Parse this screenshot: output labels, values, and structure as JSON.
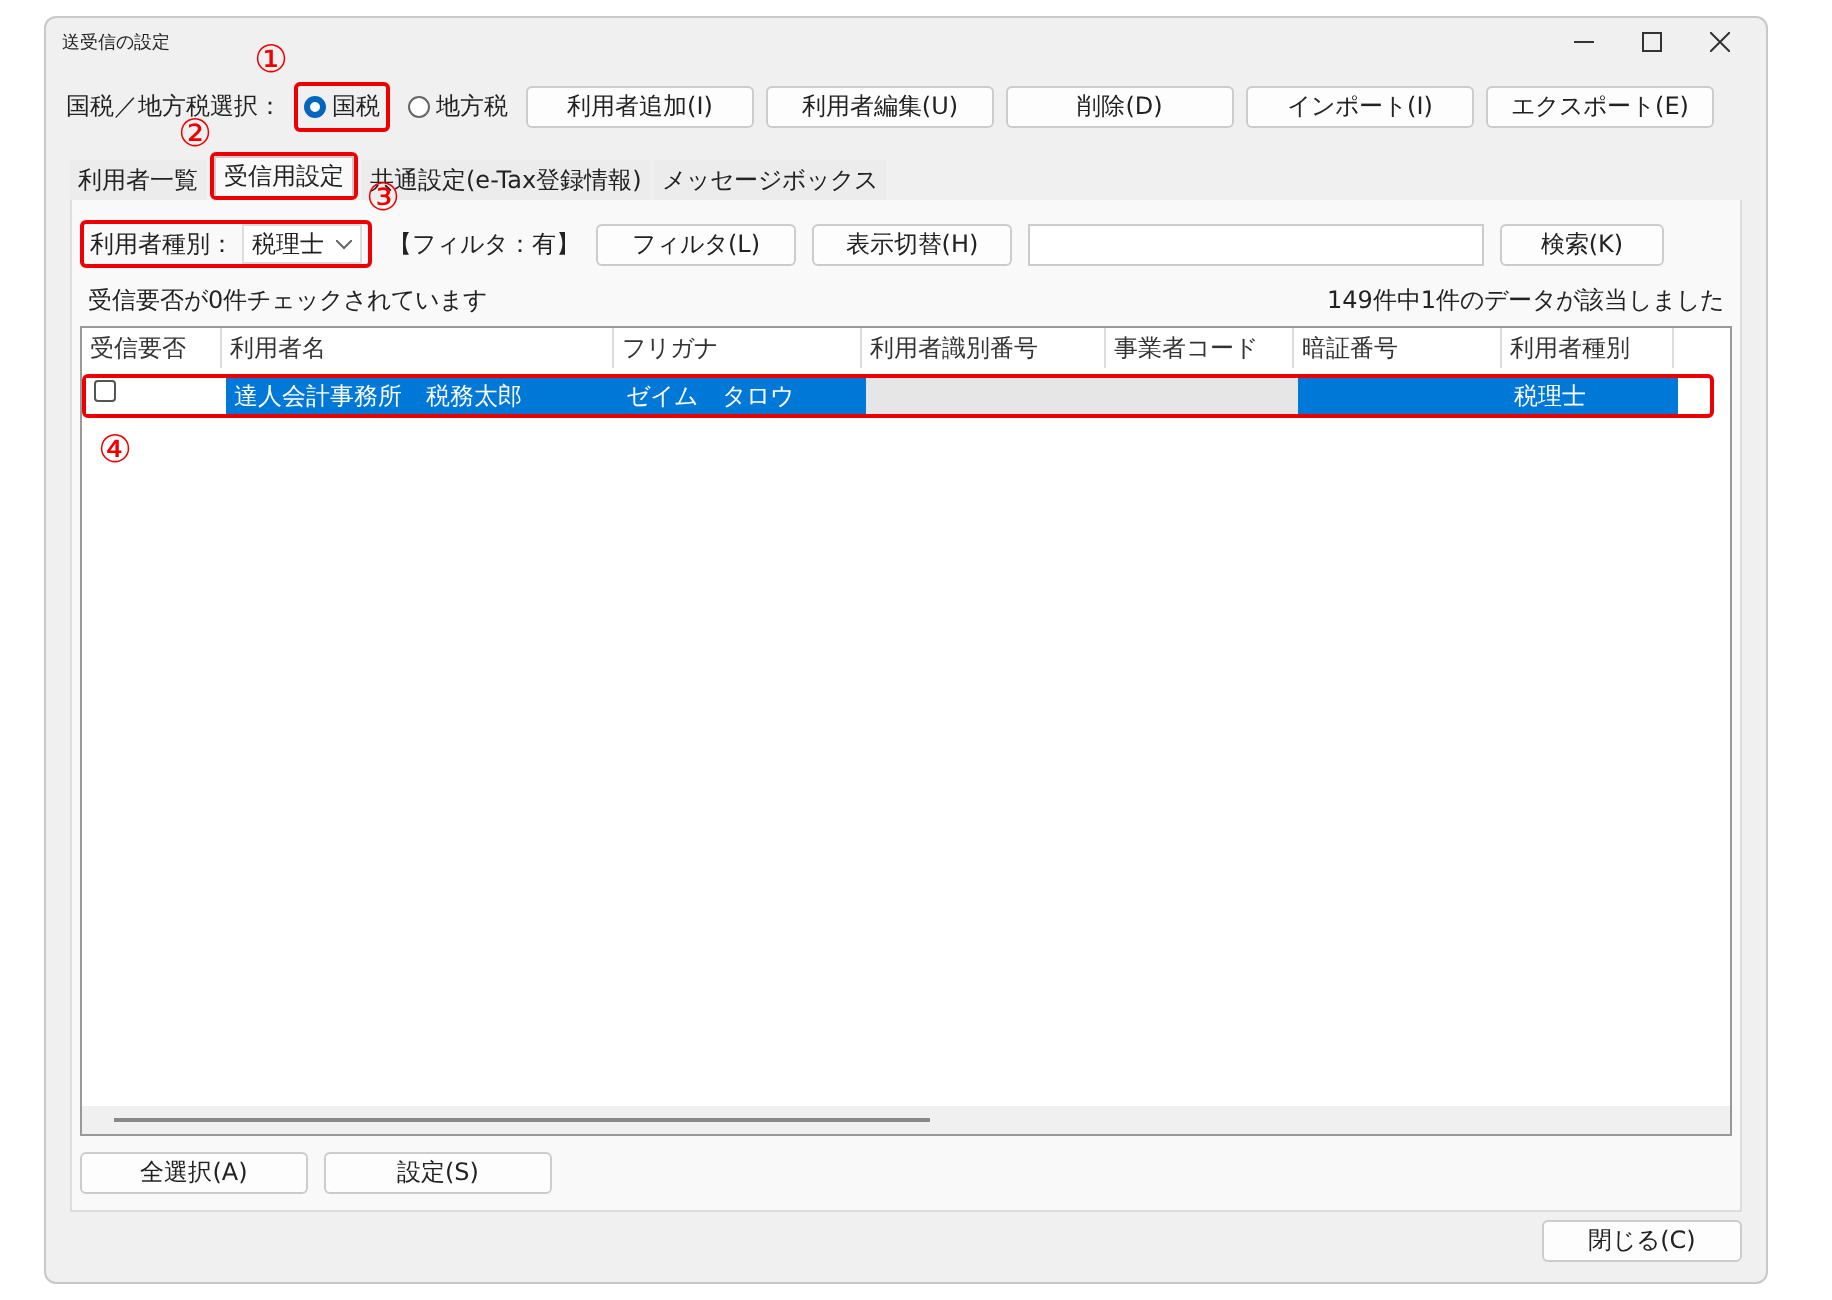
{
  "window": {
    "title": "送受信の設定"
  },
  "tax_selector": {
    "label": "国税／地方税選択：",
    "options": [
      {
        "label": "国税",
        "selected": true,
        "callout": "①"
      },
      {
        "label": "地方税",
        "selected": false
      }
    ]
  },
  "toolbar_buttons": [
    "利用者追加(I)",
    "利用者編集(U)",
    "削除(D)",
    "インポート(I)",
    "エクスポート(E)"
  ],
  "tabs": [
    {
      "label": "利用者一覧",
      "selected": false
    },
    {
      "label": "受信用設定",
      "selected": true,
      "callout": "②"
    },
    {
      "label": "共通設定(e-Tax登録情報)",
      "selected": false
    },
    {
      "label": "メッセージボックス",
      "selected": false
    }
  ],
  "filter": {
    "label": "利用者種別：",
    "value": "税理士",
    "callout": "③",
    "filter_status": "【フィルタ：有】",
    "buttons": [
      "フィルタ(L)",
      "表示切替(H)"
    ],
    "search_button": "検索(K)"
  },
  "checked_count": "受信要否が0件チェックされています",
  "match_count": "149件中1件のデータが該当しました",
  "table": {
    "columns": [
      "受信要否",
      "利用者名",
      "フリガナ",
      "利用者識別番号",
      "事業者コード",
      "暗証番号",
      "利用者種別"
    ],
    "rows": [
      {
        "checked": false,
        "selected": true,
        "callout": "④",
        "cells": [
          "",
          "達人会計事務所　税務太郎",
          "ゼイム　タロウ",
          "",
          "",
          "",
          "税理士"
        ]
      }
    ]
  },
  "bottom_buttons": [
    "全選択(A)",
    "設定(S)"
  ],
  "close_button": "閉じる(C)"
}
